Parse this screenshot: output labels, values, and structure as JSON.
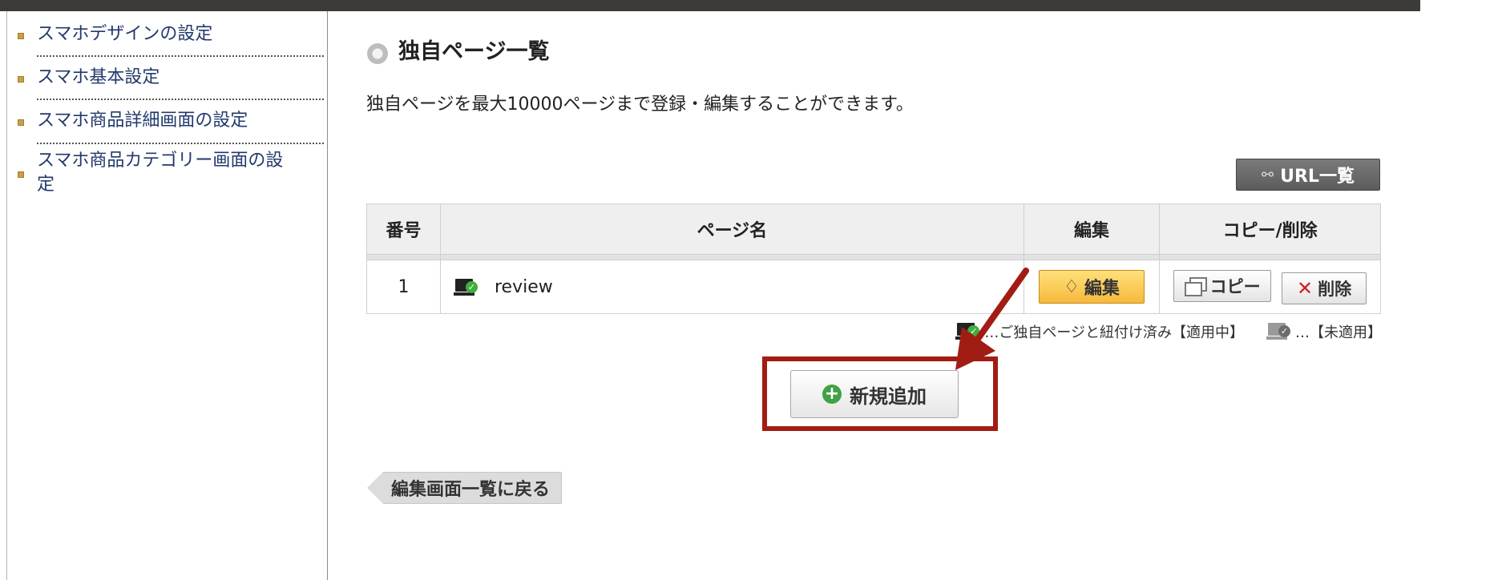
{
  "sidebar": {
    "items": [
      {
        "label": "スマホデザインの設定"
      },
      {
        "label": "スマホ基本設定"
      },
      {
        "label": "スマホ商品詳細画面の設定"
      },
      {
        "label_line1": "スマホ商品カテゴリー画面の設",
        "label_line2": "定"
      }
    ]
  },
  "main": {
    "title": "独自ページ一覧",
    "description": "独自ページを最大10000ページまで登録・編集することができます。",
    "url_list_button": "URL一覧",
    "table": {
      "headers": [
        "番号",
        "ページ名",
        "編集",
        "コピー/削除"
      ],
      "rows": [
        {
          "number": "1",
          "page_name": "review",
          "edit": "編集",
          "copy": "コピー",
          "delete": "削除"
        }
      ]
    },
    "legend": {
      "applied": "…ご独自ページと紐付け済み【適用中】",
      "not_applied": "…【未適用】"
    },
    "add_button": "新規追加",
    "back_button": "編集画面一覧に戻る"
  },
  "colors": {
    "topbar": "#3d3b38",
    "link": "#22396b",
    "highlight": "#a11d13",
    "edit_button": "#f6b93c"
  }
}
